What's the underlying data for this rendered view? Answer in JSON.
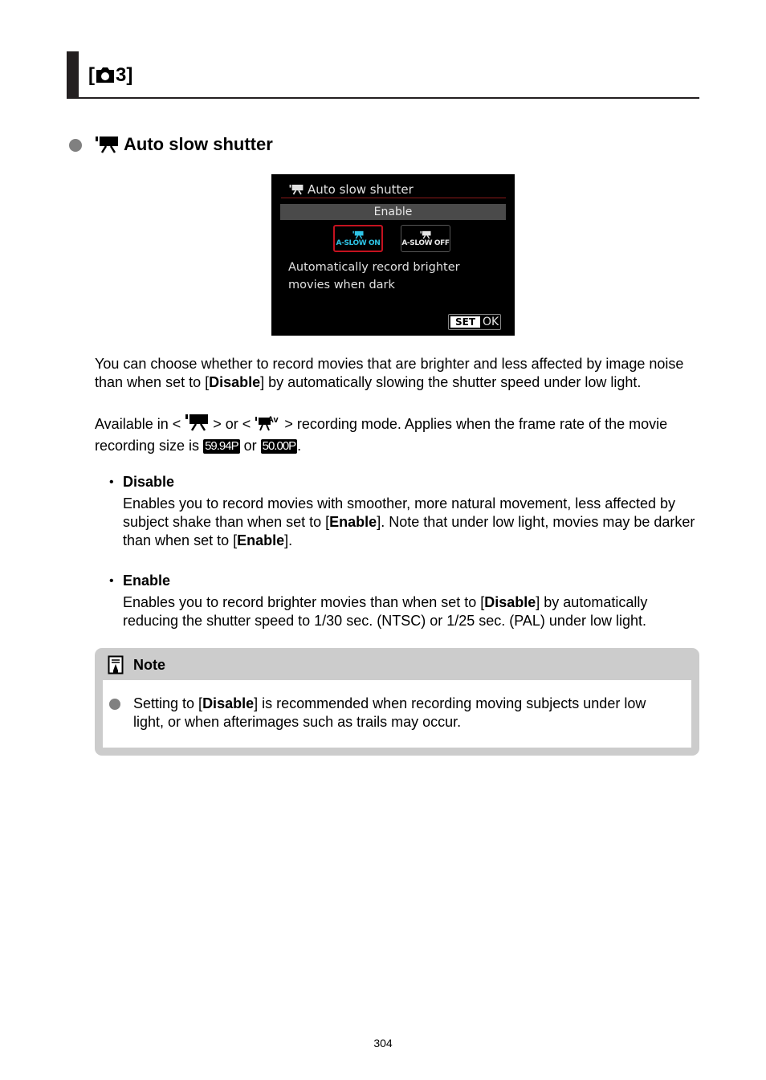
{
  "section": {
    "title_prefix": "[",
    "title_icon": "camera-shooting-icon",
    "title_suffix": "3]"
  },
  "subsection": {
    "icon": "movie-camera-icon",
    "title": "Auto slow shutter"
  },
  "camera_screen": {
    "title": "Auto slow shutter",
    "selected_value": "Enable",
    "options": [
      {
        "label": "A-SLOW ON",
        "selected": true
      },
      {
        "label": "A-SLOW OFF",
        "selected": false
      }
    ],
    "description_line1": "Automatically record brighter",
    "description_line2": "movies when dark",
    "set_label": "SET",
    "ok_label": "OK"
  },
  "intro": {
    "p1_a": "You can choose whether to record movies that are brighter and less affected by image noise than when set to [",
    "p1_bold": "Disable",
    "p1_b": "] by automatically slowing the shutter speed under low light.",
    "p2_a": "Available in <",
    "p2_b": "> or <",
    "p2_c": "> recording mode. Applies when the frame rate of the movie recording size is ",
    "rate1": "59.94P",
    "p2_or": " or ",
    "rate2": "50.00P",
    "p2_end": "."
  },
  "items": [
    {
      "title": "Disable",
      "body_a": "Enables you to record movies with smoother, more natural movement, less affected by subject shake than when set to [",
      "body_bold1": "Enable",
      "body_b": "]. Note that under low light, movies may be darker than when set to [",
      "body_bold2": "Enable",
      "body_c": "]."
    },
    {
      "title": "Enable",
      "body_a": "Enables you to record brighter movies than when set to [",
      "body_bold1": "Disable",
      "body_b": "] by automatically reducing the shutter speed to 1/30 sec. (NTSC) or 1/25 sec. (PAL) under low light."
    }
  ],
  "note": {
    "title": "Note",
    "text_a": "Setting to [",
    "text_bold": "Disable",
    "text_b": "] is recommended when recording moving subjects under low light, or when afterimages such as trails may occur."
  },
  "page_number": "304",
  "colors": {
    "header_bar": "#231f20",
    "bullet_gray": "#808080",
    "note_bg": "#cccccc",
    "screen_red": "#c4121f",
    "screen_cyan": "#2ec4e6"
  }
}
